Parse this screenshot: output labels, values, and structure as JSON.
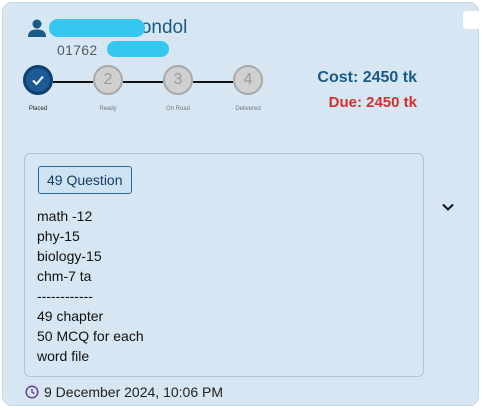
{
  "customer": {
    "name": "Mondol",
    "phone": "01762"
  },
  "stepper": {
    "steps": [
      {
        "number": "",
        "label": "Placed",
        "status": "done"
      },
      {
        "number": "2",
        "label": "Ready",
        "status": "pending"
      },
      {
        "number": "3",
        "label": "On Road",
        "status": "pending"
      },
      {
        "number": "4",
        "label": "Delivered",
        "status": "pending"
      }
    ]
  },
  "payment": {
    "cost": "Cost: 2450 tk",
    "due": "Due: 2450 tk"
  },
  "order": {
    "badge": "49  Question",
    "notes": [
      "math -12",
      "phy-15",
      "biology-15",
      "chm-7 ta",
      "------------",
      "49 chapter",
      "50 MCQ for each",
      "word file"
    ],
    "date": "9 December 2024, 10:06 PM"
  },
  "colors": {
    "primary": "#1a5a86",
    "due": "#d32f2f",
    "card_bg": "#d6e6f2",
    "clock": "#6a3fa0"
  },
  "icons": {
    "person": "person-icon",
    "check": "check-icon",
    "expand": "chevron-down-icon",
    "clock": "clock-icon"
  }
}
